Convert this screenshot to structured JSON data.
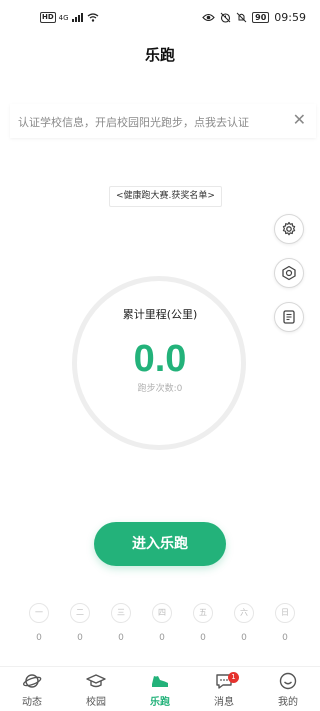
{
  "status_bar": {
    "hd": "HD",
    "network": "4G",
    "battery": "90",
    "time": "09:59"
  },
  "page": {
    "title": "乐跑"
  },
  "notice": {
    "text": "认证学校信息，开启校园阳光跑步，点我去认证"
  },
  "award_link": {
    "label": "<健康跑大赛.获奖名单>"
  },
  "side_buttons": [
    {
      "icon": "gear-icon"
    },
    {
      "icon": "badge-icon"
    },
    {
      "icon": "document-icon"
    }
  ],
  "summary": {
    "label": "累计里程(公里)",
    "distance": "0.0",
    "count_label": "跑步次数:",
    "count_value": "0"
  },
  "start_button": {
    "label": "进入乐跑"
  },
  "week": {
    "days": [
      {
        "label": "一",
        "value": "0"
      },
      {
        "label": "二",
        "value": "0"
      },
      {
        "label": "三",
        "value": "0"
      },
      {
        "label": "四",
        "value": "0"
      },
      {
        "label": "五",
        "value": "0"
      },
      {
        "label": "六",
        "value": "0"
      },
      {
        "label": "日",
        "value": "0"
      }
    ]
  },
  "tabbar": {
    "items": [
      {
        "label": "动态",
        "icon": "planet-icon"
      },
      {
        "label": "校园",
        "icon": "graduation-cap-icon"
      },
      {
        "label": "乐跑",
        "icon": "running-shoe-icon",
        "active": true
      },
      {
        "label": "消息",
        "icon": "chat-bubble-icon",
        "badge": "1"
      },
      {
        "label": "我的",
        "icon": "smiley-icon"
      }
    ]
  },
  "colors": {
    "accent": "#23b27a",
    "badge": "#e5322d",
    "muted_text": "#8a8a8a"
  }
}
